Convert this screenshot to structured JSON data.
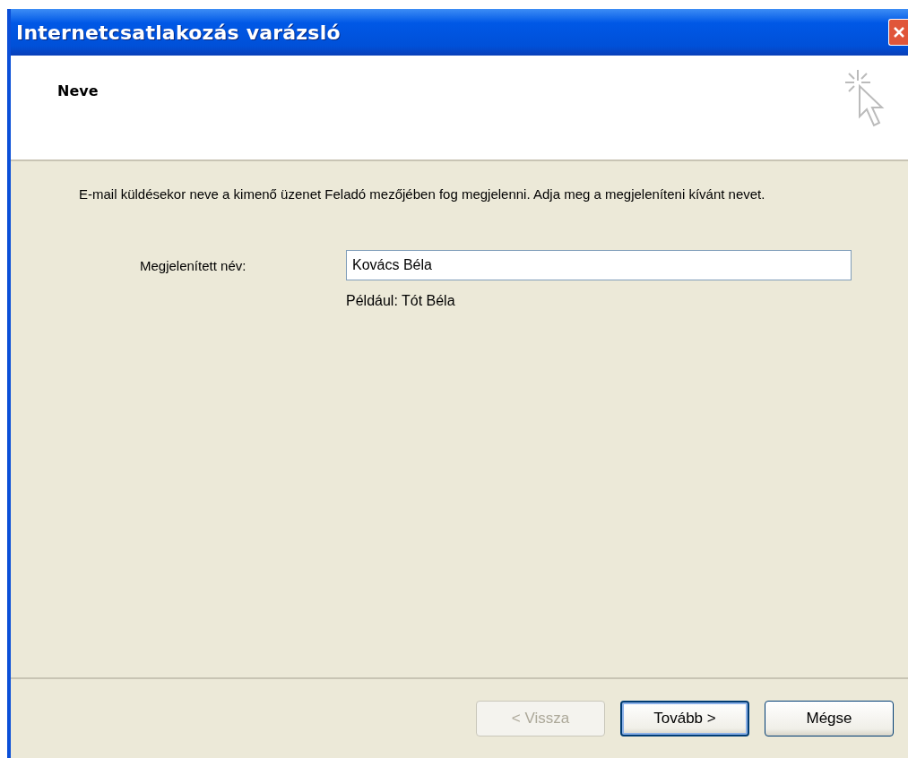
{
  "window": {
    "title": "Internetcsatlakozás varázsló"
  },
  "header": {
    "title": "Neve"
  },
  "intro": "E-mail küldésekor neve a kimenő üzenet Feladó mezőjében fog megjelenni. Adja meg a megjeleníteni kívánt nevet.",
  "field": {
    "label": "Megjelenített név:",
    "value": "Kovács Béla",
    "example": "Például: Tót Béla"
  },
  "buttons": [
    {
      "label": "< Vissza",
      "disabled": true,
      "default": false
    },
    {
      "label": "Tovább >",
      "disabled": false,
      "default": true
    },
    {
      "label": "Mégse",
      "disabled": false,
      "default": false
    }
  ]
}
